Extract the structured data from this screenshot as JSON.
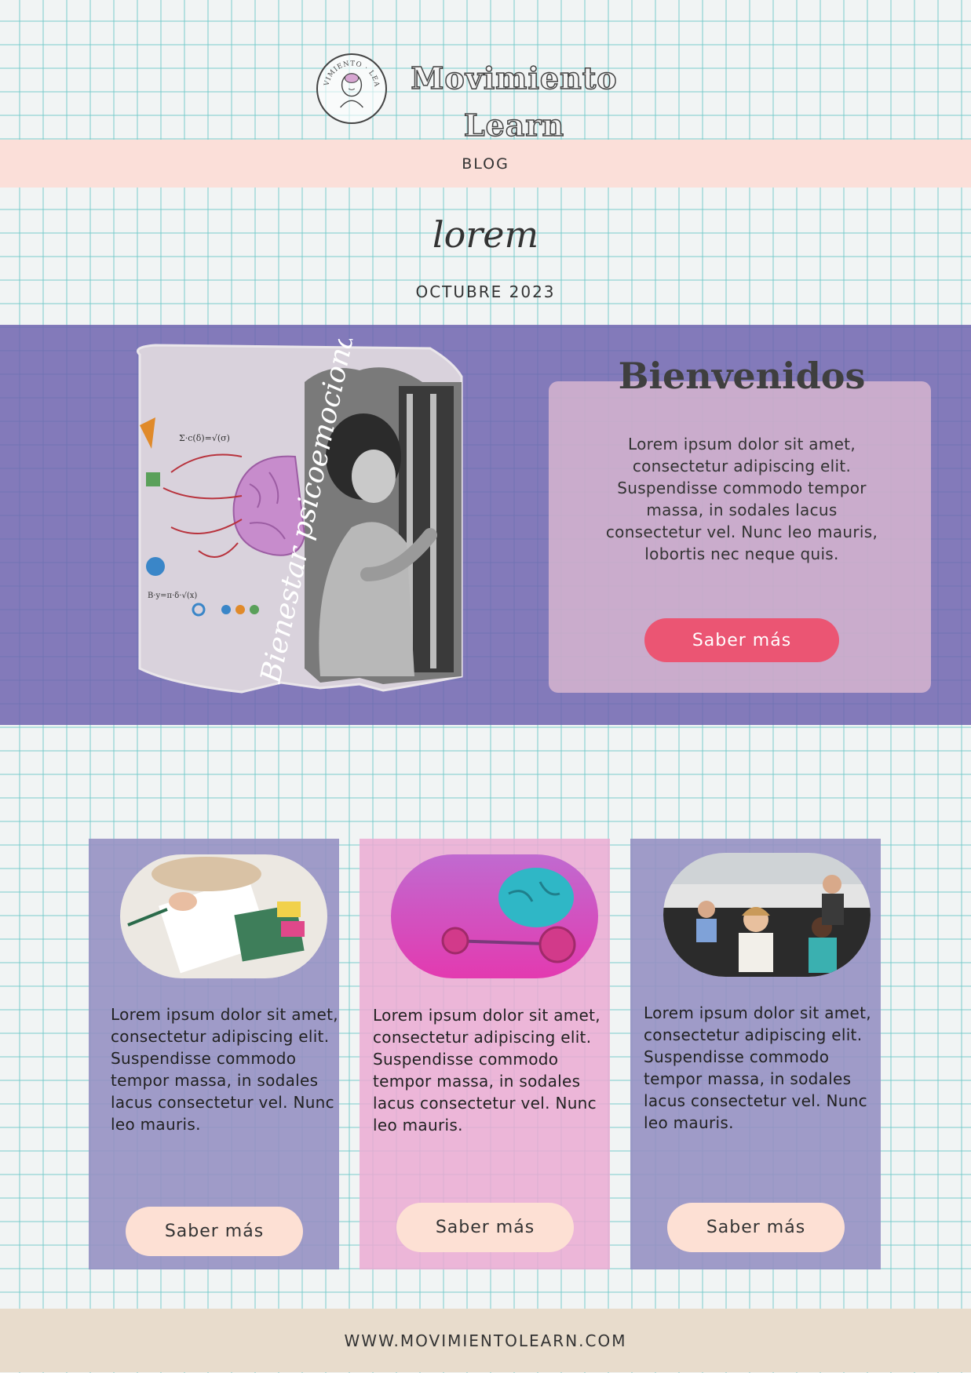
{
  "header": {
    "brand_line1": "Movimiento",
    "brand_line2": "Learn",
    "logo_icon": "brain-head-logo-icon",
    "logo_ring_text": "MOVIMIENTO · LEARN"
  },
  "nav": {
    "blog_label": "BLOG"
  },
  "issue": {
    "title": "lorem",
    "date": "OCTUBRE 2023"
  },
  "hero": {
    "image_caption": "Bienestar psicoemocional",
    "title": "Bienvenidos",
    "body": "Lorem ipsum dolor sit amet, consectetur adipiscing elit. Suspendisse commodo tempor massa, in sodales lacus consectetur vel. Nunc leo mauris, lobortis nec neque quis.",
    "button_label": "Saber más"
  },
  "cards": [
    {
      "image": "study-books-photo",
      "text": "Lorem ipsum dolor sit amet, consectetur adipiscing elit. Suspendisse commodo tempor massa, in sodales lacus consectetur vel. Nunc leo mauris.",
      "button_label": "Saber más"
    },
    {
      "image": "brain-barbell-photo",
      "text": "Lorem ipsum dolor sit amet, consectetur adipiscing elit. Suspendisse commodo tempor massa, in sodales lacus consectetur vel. Nunc leo mauris.",
      "button_label": "Saber más"
    },
    {
      "image": "classroom-photo",
      "text": "Lorem ipsum dolor sit amet, consectetur adipiscing elit. Suspendisse commodo tempor massa, in sodales lacus consectetur vel. Nunc leo mauris.",
      "button_label": "Saber más"
    }
  ],
  "footer": {
    "url": "WWW.MOVIMIENTOLEARN.COM"
  },
  "colors": {
    "nav_band": "#fbdfd9",
    "hero_band": "#7064af",
    "hero_button": "#eb5573",
    "card_lavender": "#9691c3",
    "card_pink": "#ebaad2",
    "card_button": "#fde0d4",
    "footer": "#e8dccc"
  }
}
